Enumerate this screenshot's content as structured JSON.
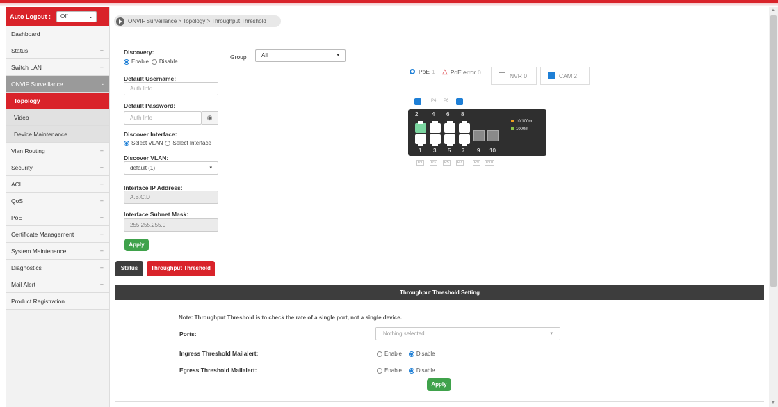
{
  "sidebar": {
    "auto_logout_label": "Auto Logout :",
    "auto_logout_value": "Off",
    "items": [
      {
        "label": "Dashboard",
        "toggle": ""
      },
      {
        "label": "Status",
        "toggle": "+"
      },
      {
        "label": "Switch LAN",
        "toggle": "+"
      },
      {
        "label": "ONVIF Surveillance",
        "toggle": "-"
      },
      {
        "label": "Topology",
        "toggle": ""
      },
      {
        "label": "Video",
        "toggle": ""
      },
      {
        "label": "Device Maintenance",
        "toggle": ""
      },
      {
        "label": "Vlan Routing",
        "toggle": "+"
      },
      {
        "label": "Security",
        "toggle": "+"
      },
      {
        "label": "ACL",
        "toggle": "+"
      },
      {
        "label": "QoS",
        "toggle": "+"
      },
      {
        "label": "PoE",
        "toggle": "+"
      },
      {
        "label": "Certificate Management",
        "toggle": "+"
      },
      {
        "label": "System Maintenance",
        "toggle": "+"
      },
      {
        "label": "Diagnostics",
        "toggle": "+"
      },
      {
        "label": "Mail Alert",
        "toggle": "+"
      },
      {
        "label": "Product Registration",
        "toggle": ""
      }
    ]
  },
  "breadcrumb": "ONVIF Surveillance > Topology > Throughput Threshold",
  "form": {
    "discovery_label": "Discovery:",
    "enable": "Enable",
    "disable": "Disable",
    "default_username_label": "Default Username:",
    "username_placeholder": "Auth Info",
    "default_password_label": "Default Password:",
    "password_placeholder": "Auth Info",
    "discover_interface_label": "Discover Interface:",
    "select_vlan": "Select VLAN",
    "select_interface": "Select Interface",
    "discover_vlan_label": "Discover VLAN:",
    "discover_vlan_value": "default (1)",
    "interface_ip_label": "Interface IP Address:",
    "interface_ip_value": "A.B.C.D",
    "interface_mask_label": "Interface Subnet Mask:",
    "interface_mask_value": "255.255.255.0",
    "apply": "Apply"
  },
  "group": {
    "label": "Group",
    "value": "All"
  },
  "legend": {
    "poe": "PoE",
    "poe_count": "1",
    "poe_error": "PoE error",
    "poe_error_count": "0",
    "nvr": "NVR 0",
    "cam": "CAM 2"
  },
  "switch_panel": {
    "top_numbers": [
      "2",
      "4",
      "6",
      "8"
    ],
    "bottom_numbers": [
      "1",
      "3",
      "5",
      "7",
      "9",
      "10"
    ],
    "top_tags": [
      "P4",
      "P6"
    ],
    "bottom_tags": [
      "P1",
      "P3",
      "P5",
      "P7",
      "P9",
      "P10"
    ],
    "speed_10_100": "10/100m",
    "speed_1000": "1000m",
    "color_10_100": "#f0a020",
    "color_1000": "#8bc34a"
  },
  "tabs": [
    {
      "label": "Status"
    },
    {
      "label": "Throughput Threshold"
    }
  ],
  "threshold": {
    "heading": "Throughput Threshold Setting",
    "note": "Note: Throughput Threshold is to check the rate of a single port, not a single device.",
    "ports_label": "Ports:",
    "ports_placeholder": "Nothing selected",
    "ingress_label": "Ingress Threshold Mailalert:",
    "egress_label": "Egress Threshold Mailalert:",
    "enable": "Enable",
    "disable": "Disable",
    "apply": "Apply"
  },
  "colors": {
    "accent": "#d9232a",
    "blue": "#1e7fd6",
    "green": "#3fa24b"
  }
}
